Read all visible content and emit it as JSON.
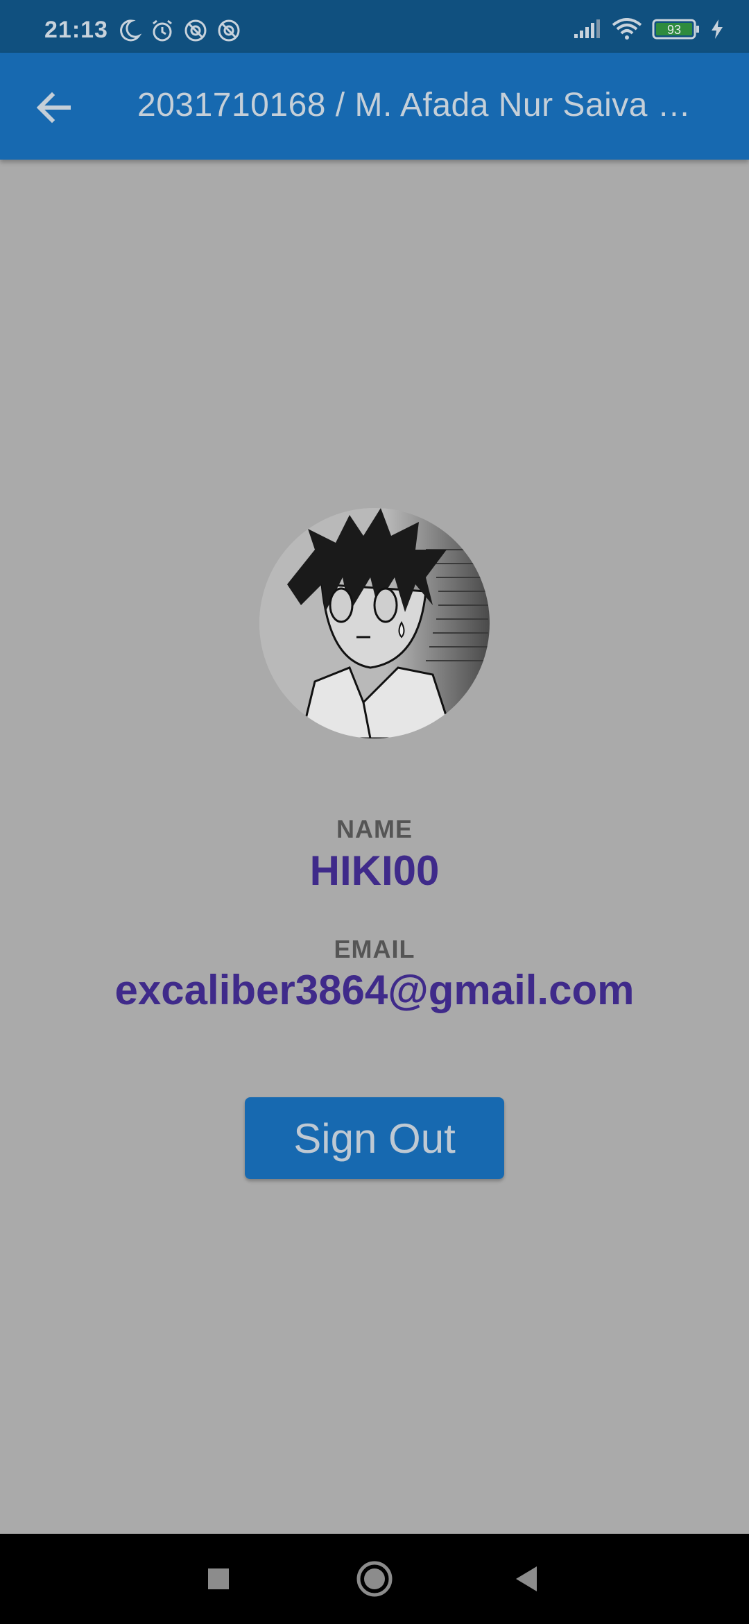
{
  "status_bar": {
    "time": "21:13",
    "left_icons": [
      "moon-icon",
      "alarm-icon",
      "blocked-icon",
      "blocked-icon"
    ],
    "right_icons": [
      "signal-icon",
      "wifi-icon",
      "battery-icon",
      "charging-icon"
    ],
    "battery_level": "93"
  },
  "app_bar": {
    "title": "2031710168 / M. Afada Nur Saiva …",
    "back_icon": "arrow-left-icon"
  },
  "profile": {
    "name_label": "NAME",
    "name_value": "HIKI00",
    "email_label": "EMAIL",
    "email_value": "excaliber3864@gmail.com",
    "sign_out_label": "Sign Out"
  },
  "nav_bar": {
    "icons": [
      "recents-square-icon",
      "home-circle-icon",
      "back-triangle-icon"
    ]
  },
  "colors": {
    "status_bar": "#10507f",
    "app_bar": "#1769b0",
    "background": "#aaaaaa",
    "accent_text": "#3f2a8a"
  }
}
